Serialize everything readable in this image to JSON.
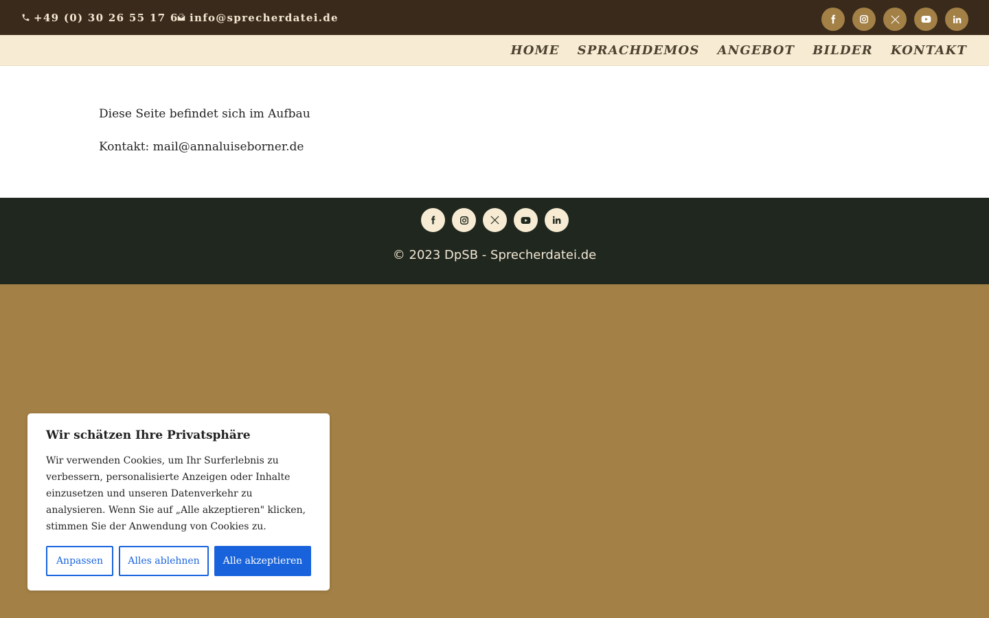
{
  "topbar": {
    "phone": "+49 (0) 30 26 55 17 63",
    "email": "info@sprecherdatei.de",
    "social": [
      "facebook-icon",
      "instagram-icon",
      "x-icon",
      "youtube-icon",
      "linkedin-icon"
    ]
  },
  "nav": {
    "items": [
      "HOME",
      "SPRACHDEMOS",
      "ANGEBOT",
      "BILDER",
      "KONTAKT"
    ]
  },
  "main": {
    "line1": "Diese Seite befindet sich im Aufbau",
    "line2": "Kontakt: mail@annaluiseborner.de"
  },
  "footer": {
    "social": [
      "facebook-icon",
      "instagram-icon",
      "x-icon",
      "youtube-icon",
      "linkedin-icon"
    ],
    "copyright": "© 2023 DpSB - Sprecherdatei.de"
  },
  "cookie": {
    "title": "Wir schätzen Ihre Privatsphäre",
    "text": "Wir verwenden Cookies, um Ihr Surferlebnis zu verbessern, personalisierte Anzeigen oder Inhalte einzusetzen und unseren Datenverkehr zu analysieren. Wenn Sie auf „Alle akzeptieren\" klicken, stimmen Sie der Anwendung von Cookies zu.",
    "customize": "Anpassen",
    "reject": "Alles ablehnen",
    "accept": "Alle akzeptieren"
  },
  "colors": {
    "topbar": "#3a2a1b",
    "navbar": "#f7ecd3",
    "footer": "#20271e",
    "page_bg": "#a38046",
    "accent_blue": "#1863dc"
  }
}
